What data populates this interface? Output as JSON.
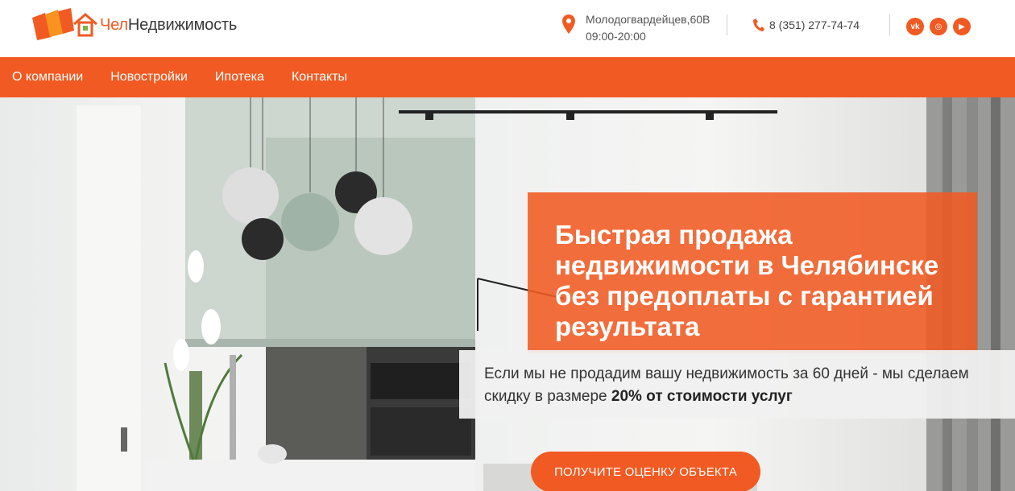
{
  "header": {
    "brand_prefix": "Чел",
    "brand_suffix": "Недвижимость",
    "address": "Молодогвардейцев,60В",
    "hours": "09:00-20:00",
    "phone": "8 (351) 277-74-74",
    "socials": [
      {
        "name": "vk",
        "label": "vk"
      },
      {
        "name": "instagram",
        "label": "◎"
      },
      {
        "name": "youtube",
        "label": "▶"
      }
    ]
  },
  "nav": {
    "items": [
      {
        "label": "О компании"
      },
      {
        "label": "Новостройки"
      },
      {
        "label": "Ипотека"
      },
      {
        "label": "Контакты"
      }
    ]
  },
  "hero": {
    "title": "Быстрая продажа недвижимости в Челябинске без предоплаты с гарантией результата",
    "guarantee_text": "Если мы не продадим вашу недвижимость за 60 дней - мы сделаем скидку в размере",
    "guarantee_bold": "20% от стоимости услуг",
    "cta_label": "ПОЛУЧИТЕ ОЦЕНКУ ОБЪЕКТА"
  },
  "colors": {
    "accent": "#f15a22",
    "text_dark": "#333333"
  }
}
